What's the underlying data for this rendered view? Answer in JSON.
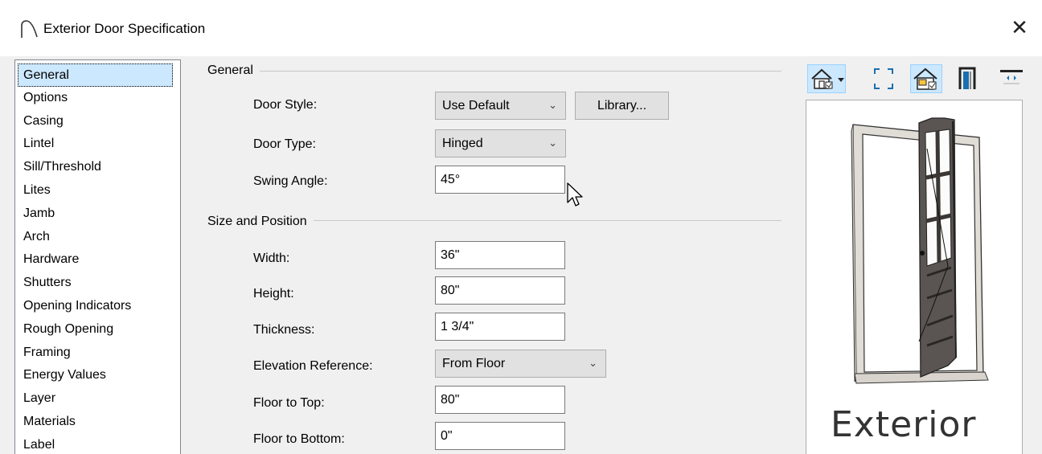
{
  "window": {
    "title": "Exterior Door Specification",
    "close_glyph": "✕"
  },
  "sidebar": {
    "items": [
      {
        "label": "General",
        "selected": true
      },
      {
        "label": "Options"
      },
      {
        "label": "Casing"
      },
      {
        "label": "Lintel"
      },
      {
        "label": "Sill/Threshold"
      },
      {
        "label": "Lites"
      },
      {
        "label": "Jamb"
      },
      {
        "label": "Arch"
      },
      {
        "label": "Hardware"
      },
      {
        "label": "Shutters"
      },
      {
        "label": "Opening Indicators"
      },
      {
        "label": "Rough Opening"
      },
      {
        "label": "Framing"
      },
      {
        "label": "Energy Values"
      },
      {
        "label": "Layer"
      },
      {
        "label": "Materials"
      },
      {
        "label": "Label"
      }
    ]
  },
  "general": {
    "heading": "General",
    "door_style": {
      "label": "Door Style:",
      "value": "Use Default"
    },
    "library_button": "Library...",
    "door_type": {
      "label": "Door Type:",
      "value": "Hinged"
    },
    "swing_angle": {
      "label": "Swing Angle:",
      "value": "45°"
    }
  },
  "size_position": {
    "heading": "Size and Position",
    "width": {
      "label": "Width:",
      "value": "36\""
    },
    "height": {
      "label": "Height:",
      "value": "80\""
    },
    "thickness": {
      "label": "Thickness:",
      "value": "1 3/4\""
    },
    "elevation_reference": {
      "label": "Elevation Reference:",
      "value": "From Floor"
    },
    "floor_to_top": {
      "label": "Floor to Top:",
      "value": "80\""
    },
    "floor_to_bottom": {
      "label": "Floor to Bottom:",
      "value": "0\""
    }
  },
  "preview": {
    "caption": "Exterior",
    "toolbar": [
      "view-type-icon",
      "dropdown-arrow-icon",
      "fill-window-icon",
      "show-room-icon",
      "door-jamb-icon",
      "swap-icon"
    ]
  },
  "colors": {
    "selection": "#cce8ff",
    "dialog_bg": "#f0f0f0",
    "button_bg": "#e1e1e1"
  }
}
